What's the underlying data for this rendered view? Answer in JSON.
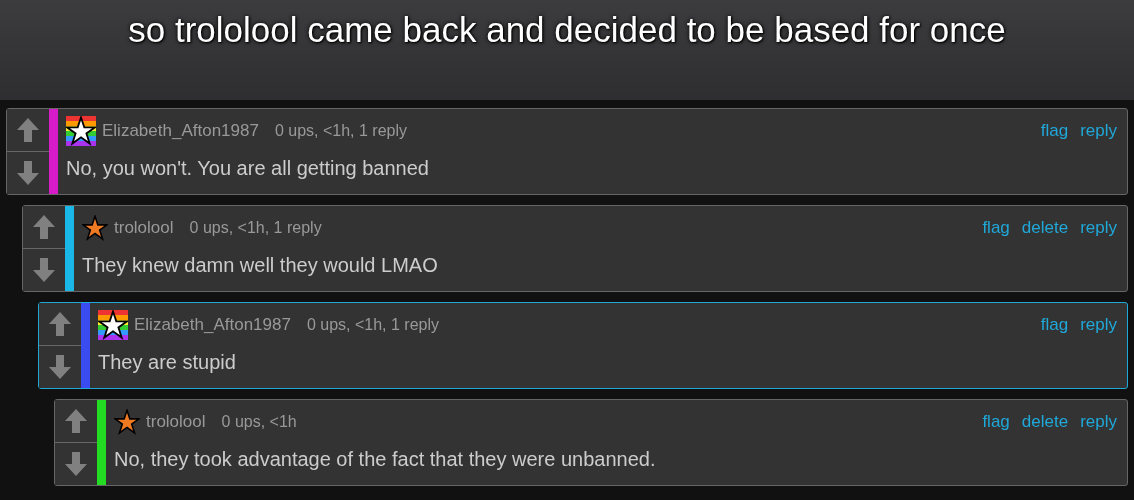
{
  "caption": "so trololool came back and decided to be based for once",
  "comments": [
    {
      "kind": "rainbow",
      "username": "Elizabeth_Afton1987",
      "meta": "0 ups, <1h, 1 reply",
      "actions": [
        "flag",
        "reply"
      ],
      "text": "No, you won't. You are all getting banned",
      "color": "#d81bc8",
      "highlighted": false,
      "children": [
        {
          "kind": "orange",
          "username": "trololool",
          "meta": "0 ups, <1h, 1 reply",
          "actions": [
            "flag",
            "delete",
            "reply"
          ],
          "text": "They knew damn well they would LMAO",
          "color": "#1ab8e8",
          "highlighted": false,
          "children": [
            {
              "kind": "rainbow",
              "username": "Elizabeth_Afton1987",
              "meta": "0 ups, <1h, 1 reply",
              "actions": [
                "flag",
                "reply"
              ],
              "text": "They are stupid",
              "color": "#3a4cf0",
              "highlighted": true,
              "children": [
                {
                  "kind": "orange",
                  "username": "trololool",
                  "meta": "0 ups, <1h",
                  "actions": [
                    "flag",
                    "delete",
                    "reply"
                  ],
                  "text": "No, they took advantage of the fact that they were unbanned.",
                  "color": "#22dd22",
                  "highlighted": false
                }
              ]
            }
          ]
        }
      ]
    }
  ]
}
